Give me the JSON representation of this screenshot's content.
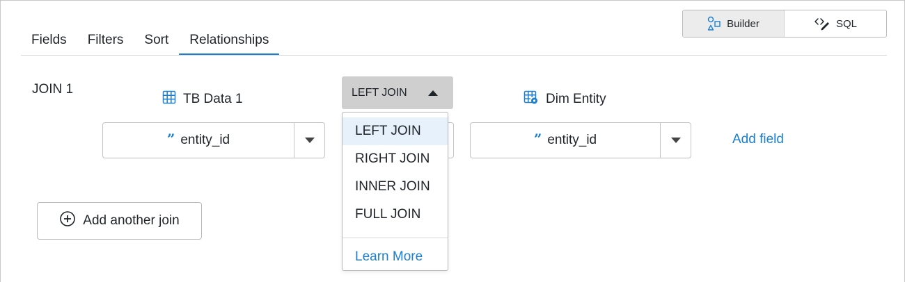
{
  "mode_toggle": {
    "builder_label": "Builder",
    "sql_label": "SQL",
    "active": "Builder"
  },
  "tabs": [
    {
      "label": "Fields",
      "active": false
    },
    {
      "label": "Filters",
      "active": false
    },
    {
      "label": "Sort",
      "active": false
    },
    {
      "label": "Relationships",
      "active": true
    }
  ],
  "join": {
    "label": "JOIN 1",
    "left_table": {
      "name": "TB Data 1",
      "icon": "table-grid-icon"
    },
    "right_table": {
      "name": "Dim Entity",
      "icon": "linked-table-icon"
    },
    "left_field": "entity_id",
    "right_field": "entity_id",
    "join_type": "LEFT JOIN",
    "add_field_label": "Add field"
  },
  "join_menu": {
    "options": [
      "LEFT JOIN",
      "RIGHT JOIN",
      "INNER JOIN",
      "FULL JOIN"
    ],
    "selected": "LEFT JOIN",
    "learn_more_label": "Learn More"
  },
  "add_join_label": "Add another join",
  "colors": {
    "accent": "#1a7fd1",
    "selected_item_bg": "#e6f1fb",
    "trigger_bg": "#cfcfcf",
    "toggle_active_bg": "#ececec"
  }
}
